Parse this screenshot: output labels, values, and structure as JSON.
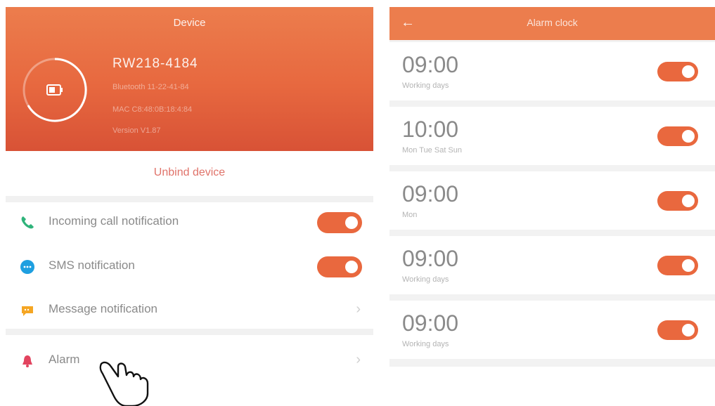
{
  "device": {
    "header_title": "Device",
    "name": "RW218-4184",
    "info_lines": [
      "Bluetooth 11-22-41-84",
      "MAC C8:48:0B:18:4:84",
      "Version V1.87"
    ]
  },
  "unbind": {
    "label": "Unbind device"
  },
  "settings": [
    {
      "label": "Incoming call notification",
      "icon": "phone-icon",
      "control": "toggle",
      "on": true
    },
    {
      "label": "SMS notification",
      "icon": "sms-icon",
      "control": "toggle",
      "on": true
    },
    {
      "label": "Message notification",
      "icon": "message-icon",
      "control": "chevron"
    },
    {
      "label": "Alarm",
      "icon": "alarm-icon",
      "control": "chevron"
    }
  ],
  "alarm_screen": {
    "title": "Alarm clock",
    "alarms": [
      {
        "time": "09:00",
        "repeat": "Working days",
        "on": true
      },
      {
        "time": "10:00",
        "repeat": "Mon Tue Sat Sun",
        "on": true
      },
      {
        "time": "09:00",
        "repeat": "Mon",
        "on": true
      },
      {
        "time": "09:00",
        "repeat": "Working days",
        "on": true
      },
      {
        "time": "09:00",
        "repeat": "Working days",
        "on": true
      }
    ]
  },
  "colors": {
    "accent": "#e9683e",
    "header_top": "#ec7d4d",
    "header_bottom": "#d85236",
    "unbind_text": "#e0736a"
  }
}
